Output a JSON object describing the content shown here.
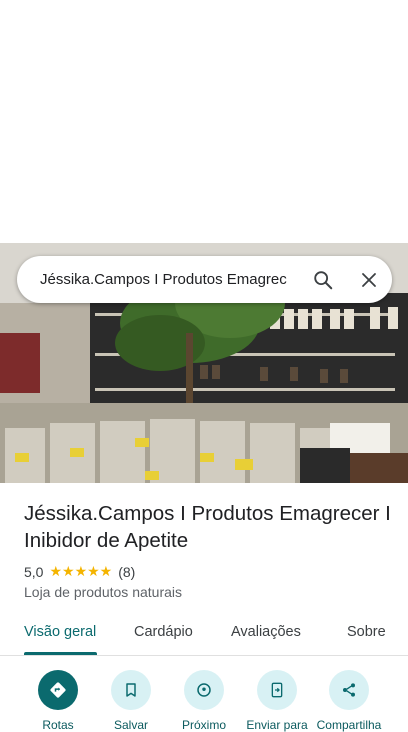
{
  "search": {
    "query": "Jéssika.Campos I Produtos Emagrec"
  },
  "place": {
    "title": "Jéssika.Campos I Produtos Emagrecer I Inibidor de Apetite",
    "rating": "5,0",
    "stars": "★★★★★",
    "review_count": "(8)",
    "category": "Loja de produtos naturais"
  },
  "tabs": [
    {
      "label": "Visão geral",
      "active": true
    },
    {
      "label": "Cardápio",
      "active": false
    },
    {
      "label": "Avaliações",
      "active": false
    },
    {
      "label": "Sobre",
      "active": false
    }
  ],
  "actions": [
    {
      "label": "Rotas",
      "icon": "directions-icon"
    },
    {
      "label": "Salvar",
      "icon": "bookmark-icon"
    },
    {
      "label": "Próximo",
      "icon": "nearby-icon"
    },
    {
      "label": "Enviar para",
      "icon": "send-to-phone-icon"
    },
    {
      "label": "Compartilha",
      "icon": "share-icon"
    }
  ],
  "colors": {
    "accent": "#0b6a6e",
    "action_bg": "#d8f1f4",
    "star": "#f4b400"
  }
}
